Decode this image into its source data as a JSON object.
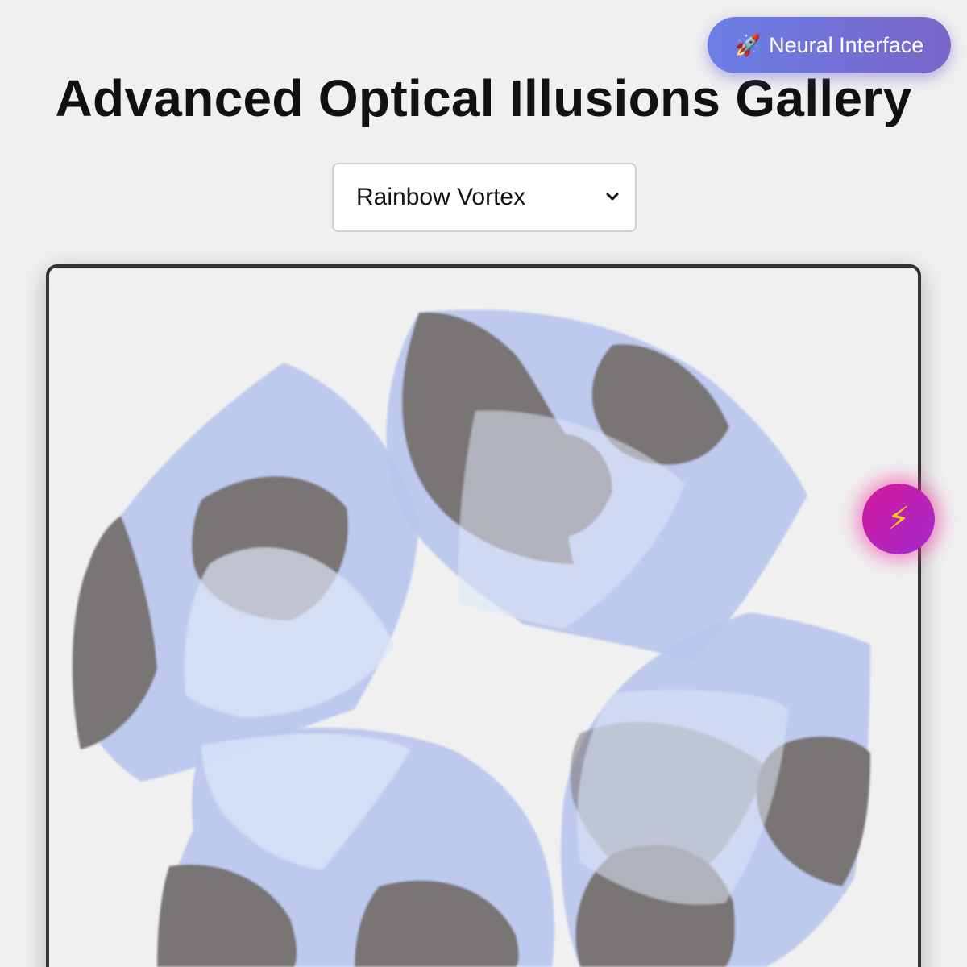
{
  "header": {
    "title": "Advanced Optical Illusions Gallery"
  },
  "badge": {
    "icon": "rocket-icon",
    "label": "Neural Interface",
    "colors": [
      "#6a7fe6",
      "#7a65c8"
    ]
  },
  "illusion_select": {
    "selected": "Rainbow Vortex"
  },
  "illusion_canvas": {
    "colors": {
      "blue": "#b9c7ee",
      "pale": "#dde7f8",
      "grey": "#7a7474"
    }
  },
  "action_button": {
    "icon": "lightning-bolt-icon",
    "colors": [
      "#d6189a",
      "#a02ad0"
    ]
  }
}
